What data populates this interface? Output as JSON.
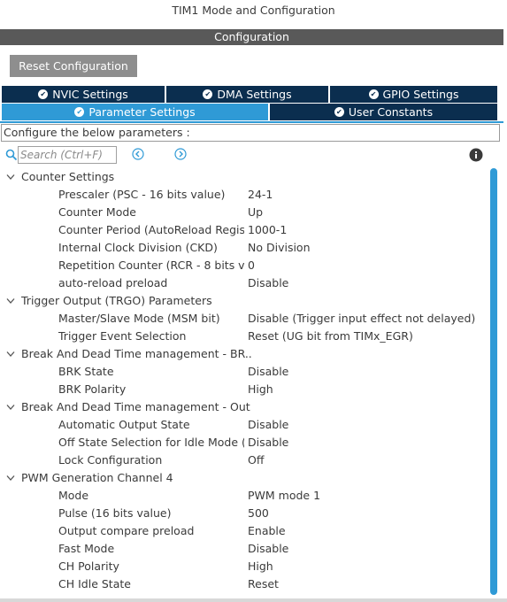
{
  "window": {
    "title": "TIM1 Mode and Configuration"
  },
  "config_bar": {
    "label": "Configuration"
  },
  "reset_button": {
    "label": "Reset Configuration"
  },
  "tabs_top": [
    {
      "label": "NVIC Settings",
      "active": false
    },
    {
      "label": "DMA Settings",
      "active": false
    },
    {
      "label": "GPIO Settings",
      "active": false
    }
  ],
  "tabs_bottom": [
    {
      "label": "Parameter Settings",
      "active": true
    },
    {
      "label": "User Constants",
      "active": false
    }
  ],
  "hint": {
    "text": "Configure the below parameters :"
  },
  "search": {
    "placeholder": "Search (Ctrl+F)",
    "value": ""
  },
  "icons": {
    "search": "search-icon",
    "prev": "chevron-left-circle-icon",
    "next": "chevron-right-circle-icon",
    "info": "info-icon",
    "tab_check": "check-circle-icon",
    "group_caret": "chevron-down-icon"
  },
  "colors": {
    "tab_dark": "#0b2e4f",
    "tab_active": "#2f9ad6",
    "config_bar": "#595959",
    "reset_button": "#8e8e8e",
    "scrollbar": "#2f9ad6"
  },
  "groups": [
    {
      "name": "Counter Settings",
      "params": [
        {
          "name": "Prescaler (PSC - 16 bits value)",
          "value": "24-1"
        },
        {
          "name": "Counter Mode",
          "value": "Up"
        },
        {
          "name": "Counter Period (AutoReload Regis...",
          "value": "1000-1"
        },
        {
          "name": "Internal Clock Division (CKD)",
          "value": "No Division"
        },
        {
          "name": "Repetition Counter (RCR - 8 bits v...",
          "value": "0"
        },
        {
          "name": "auto-reload preload",
          "value": "Disable"
        }
      ]
    },
    {
      "name": "Trigger Output (TRGO) Parameters",
      "params": [
        {
          "name": "Master/Slave Mode (MSM bit)",
          "value": "Disable (Trigger input effect not delayed)"
        },
        {
          "name": "Trigger Event Selection",
          "value": "Reset (UG bit from TIMx_EGR)"
        }
      ]
    },
    {
      "name": "Break And Dead Time management - BR...",
      "params": [
        {
          "name": "BRK State",
          "value": "Disable"
        },
        {
          "name": "BRK Polarity",
          "value": "High"
        }
      ]
    },
    {
      "name": "Break And Dead Time management - Out...",
      "params": [
        {
          "name": "Automatic Output State",
          "value": "Disable"
        },
        {
          "name": "Off State Selection for Idle Mode (...",
          "value": "Disable"
        },
        {
          "name": "Lock Configuration",
          "value": "Off"
        }
      ]
    },
    {
      "name": "PWM Generation Channel 4",
      "params": [
        {
          "name": "Mode",
          "value": "PWM mode 1"
        },
        {
          "name": "Pulse (16 bits value)",
          "value": "500"
        },
        {
          "name": "Output compare preload",
          "value": "Enable"
        },
        {
          "name": "Fast Mode",
          "value": "Disable"
        },
        {
          "name": "CH Polarity",
          "value": "High"
        },
        {
          "name": "CH Idle State",
          "value": "Reset"
        }
      ]
    }
  ]
}
